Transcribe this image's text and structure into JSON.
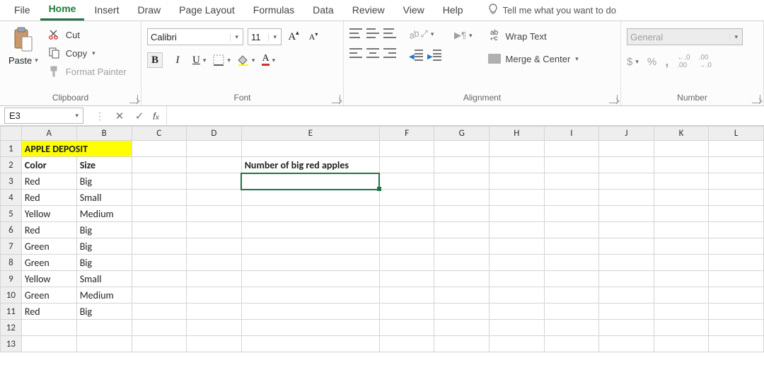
{
  "tabs": {
    "items": [
      "File",
      "Home",
      "Insert",
      "Draw",
      "Page Layout",
      "Formulas",
      "Data",
      "Review",
      "View",
      "Help"
    ],
    "active": "Home",
    "tell_me": "Tell me what you want to do"
  },
  "ribbon": {
    "clipboard": {
      "label": "Clipboard",
      "paste": "Paste",
      "cut": "Cut",
      "copy": "Copy",
      "format_painter": "Format Painter"
    },
    "font": {
      "label": "Font",
      "name": "Calibri",
      "size": "11"
    },
    "alignment": {
      "label": "Alignment",
      "wrap_text": "Wrap Text",
      "merge_center": "Merge & Center"
    },
    "number": {
      "label": "Number",
      "format": "General",
      "currency": "$",
      "percent": "%",
      "comma": ","
    }
  },
  "formula_bar": {
    "name_box": "E3",
    "formula": ""
  },
  "grid": {
    "columns": [
      "A",
      "B",
      "C",
      "D",
      "E",
      "F",
      "G",
      "H",
      "I",
      "J",
      "K",
      "L"
    ],
    "row_count": 13,
    "selected_cell": "E3",
    "cells": {
      "A1": {
        "v": "APPLE DEPOSIT",
        "cls": "hl-yellow",
        "span": 2
      },
      "A2": {
        "v": "Color",
        "cls": "hdr-bold"
      },
      "B2": {
        "v": "Size",
        "cls": "hdr-bold"
      },
      "E2": {
        "v": "Number of big red apples",
        "cls": "hdr-bold"
      },
      "A3": {
        "v": "Red"
      },
      "B3": {
        "v": "Big"
      },
      "A4": {
        "v": "Red"
      },
      "B4": {
        "v": "Small"
      },
      "A5": {
        "v": "Yellow"
      },
      "B5": {
        "v": "Medium"
      },
      "A6": {
        "v": "Red"
      },
      "B6": {
        "v": "Big"
      },
      "A7": {
        "v": "Green"
      },
      "B7": {
        "v": "Big"
      },
      "A8": {
        "v": "Green"
      },
      "B8": {
        "v": "Big"
      },
      "A9": {
        "v": "Yellow"
      },
      "B9": {
        "v": "Small"
      },
      "A10": {
        "v": "Green"
      },
      "B10": {
        "v": "Medium"
      },
      "A11": {
        "v": "Red"
      },
      "B11": {
        "v": "Big"
      }
    }
  },
  "chart_data": {
    "type": "table",
    "title": "APPLE DEPOSIT",
    "columns": [
      "Color",
      "Size"
    ],
    "rows": [
      [
        "Red",
        "Big"
      ],
      [
        "Red",
        "Small"
      ],
      [
        "Yellow",
        "Medium"
      ],
      [
        "Red",
        "Big"
      ],
      [
        "Green",
        "Big"
      ],
      [
        "Green",
        "Big"
      ],
      [
        "Yellow",
        "Small"
      ],
      [
        "Green",
        "Medium"
      ],
      [
        "Red",
        "Big"
      ]
    ],
    "query_label": "Number of big red apples"
  }
}
